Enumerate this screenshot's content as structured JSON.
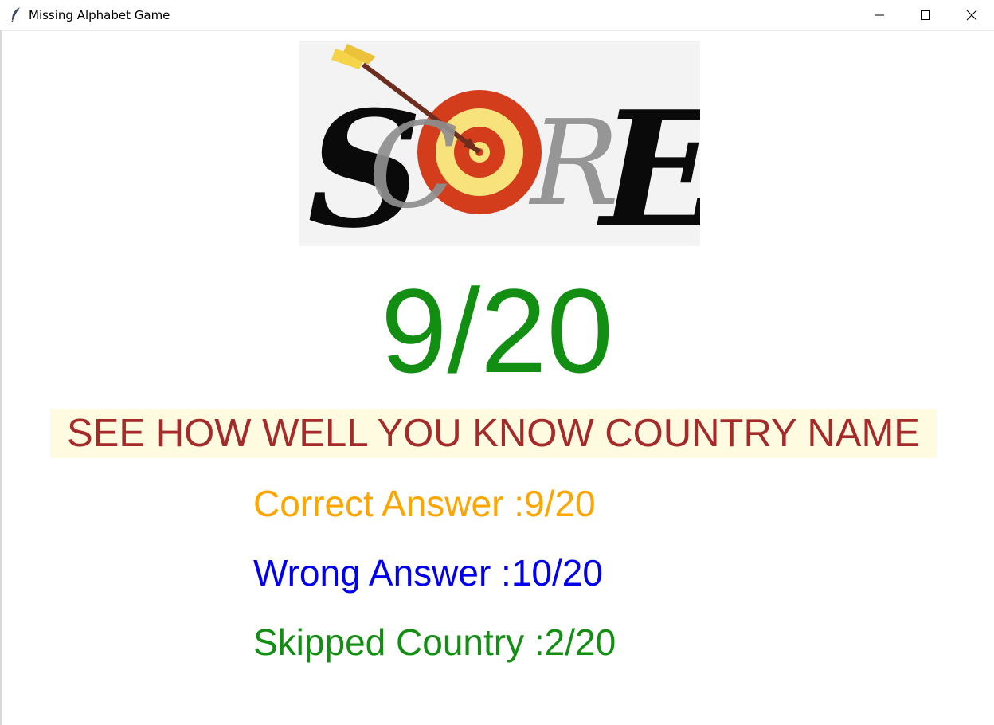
{
  "window": {
    "title": "Missing Alphabet Game",
    "app_icon": "feather-icon",
    "controls": [
      "minimize-icon",
      "maximize-icon",
      "close-icon"
    ]
  },
  "logo": {
    "text": "SCORE",
    "icon": "archery-target-arrow-icon"
  },
  "score": {
    "display": "9/20"
  },
  "banner": {
    "text": "SEE HOW WELL YOU KNOW COUNTRY NAME"
  },
  "stats": {
    "correct": "Correct Answer :9/20",
    "wrong": "Wrong Answer :10/20",
    "skipped": "Skipped Country :2/20"
  },
  "colors": {
    "score": "#128f12",
    "banner_text": "#a52a2a",
    "banner_bg": "#fffbe0",
    "correct": "#ffa500",
    "wrong": "#0000ee",
    "skipped": "#128f12"
  }
}
